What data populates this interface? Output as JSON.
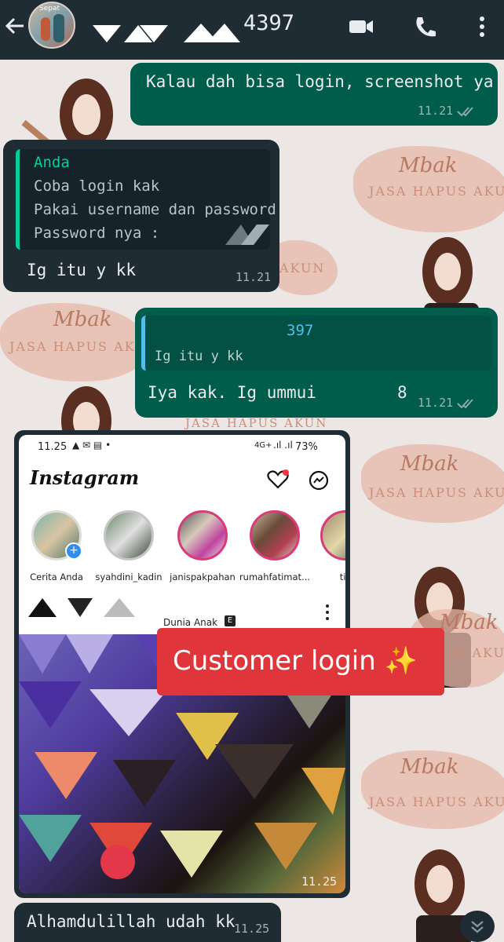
{
  "header": {
    "contact_name": "4397",
    "back_icon": "arrow-left-icon",
    "avatar_badge": "Sepat",
    "icons": [
      "video-call-icon",
      "voice-call-icon",
      "more-vert-icon"
    ],
    "bg_color": "#1f2c34"
  },
  "wallpaper": {
    "brand": "Mbak",
    "tagline": "JASA HAPUS AKUN",
    "tagline_partial_1": "AKUN",
    "tagline_partial_2": "JASA HAPUS AKUN",
    "tagline_partial_3": "JASA HAPUS AK",
    "tagline_partial_4": "US AKUN",
    "tagline_partial_5": "JASA HAPUS AKUN",
    "brand_partial": "Mbak"
  },
  "messages": [
    {
      "direction": "out",
      "text": "Kalau dah bisa login, screenshot ya kk",
      "time": "11.21",
      "status": "read"
    },
    {
      "direction": "in",
      "quote_author": "Anda",
      "quote_lines": [
        "Coba login kak",
        "Pakai username dan password",
        "Password nya :"
      ],
      "text": "Ig itu y kk",
      "time": "11.21"
    },
    {
      "direction": "out",
      "quote_author": "397",
      "quote_text": "Ig itu y kk",
      "text": "Iya kak. Ig ummui",
      "text_suffix": "8",
      "time": "11.21",
      "status": "read"
    },
    {
      "direction": "in",
      "type": "image",
      "time": "11.25"
    },
    {
      "direction": "in",
      "text": "Alhamdulillah udah kk",
      "time": "11.25"
    }
  ],
  "instagram_screenshot": {
    "status_time": "11.25",
    "status_battery": "73%",
    "status_network": "4G+",
    "app_name": "Instagram",
    "stories": [
      {
        "label": "Cerita Anda"
      },
      {
        "label": "syahdini_kadin"
      },
      {
        "label": "janispakpahan"
      },
      {
        "label": "rumahfatimat..."
      },
      {
        "label": "tiy"
      }
    ],
    "post_author": "Dunia Anak",
    "post_badge": "E",
    "icons": [
      "heart-icon",
      "messenger-icon",
      "more-vert-icon"
    ]
  },
  "banner": {
    "text": "Customer login ✨",
    "color": "#e0353b"
  },
  "colors": {
    "outgoing_bubble": "#005c4b",
    "incoming_bubble": "#1f2c34",
    "read_ticks": "#53bdeb",
    "quote_author_in": "#06cf9c"
  }
}
